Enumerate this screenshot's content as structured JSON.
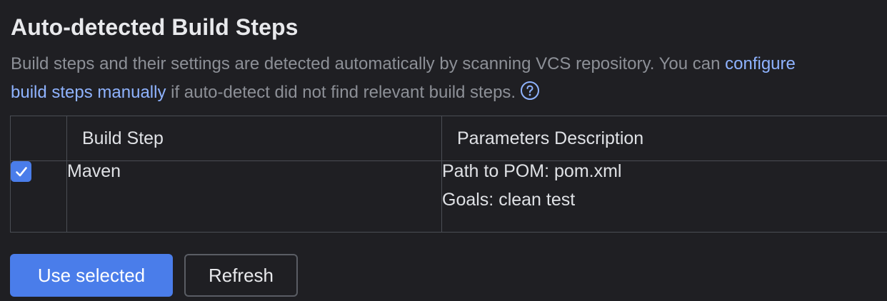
{
  "header": {
    "title": "Auto-detected Build Steps",
    "description_prefix": "Build steps and their settings are detected automatically by scanning VCS repository. You can ",
    "link_part1": "configure",
    "link_part2": "build steps manually",
    "description_suffix": " if auto-detect did not find relevant build steps.",
    "help_icon": "question-circle-icon"
  },
  "table": {
    "columns": [
      "",
      "Build Step",
      "Parameters Description"
    ],
    "rows": [
      {
        "checked": true,
        "build_step": "Maven",
        "params": [
          "Path to POM: pom.xml",
          "Goals: clean test"
        ]
      }
    ]
  },
  "actions": {
    "use_selected_label": "Use selected",
    "refresh_label": "Refresh"
  },
  "colors": {
    "accent": "#4a7dea",
    "link": "#8fb3ff",
    "background": "#1f1f23"
  }
}
